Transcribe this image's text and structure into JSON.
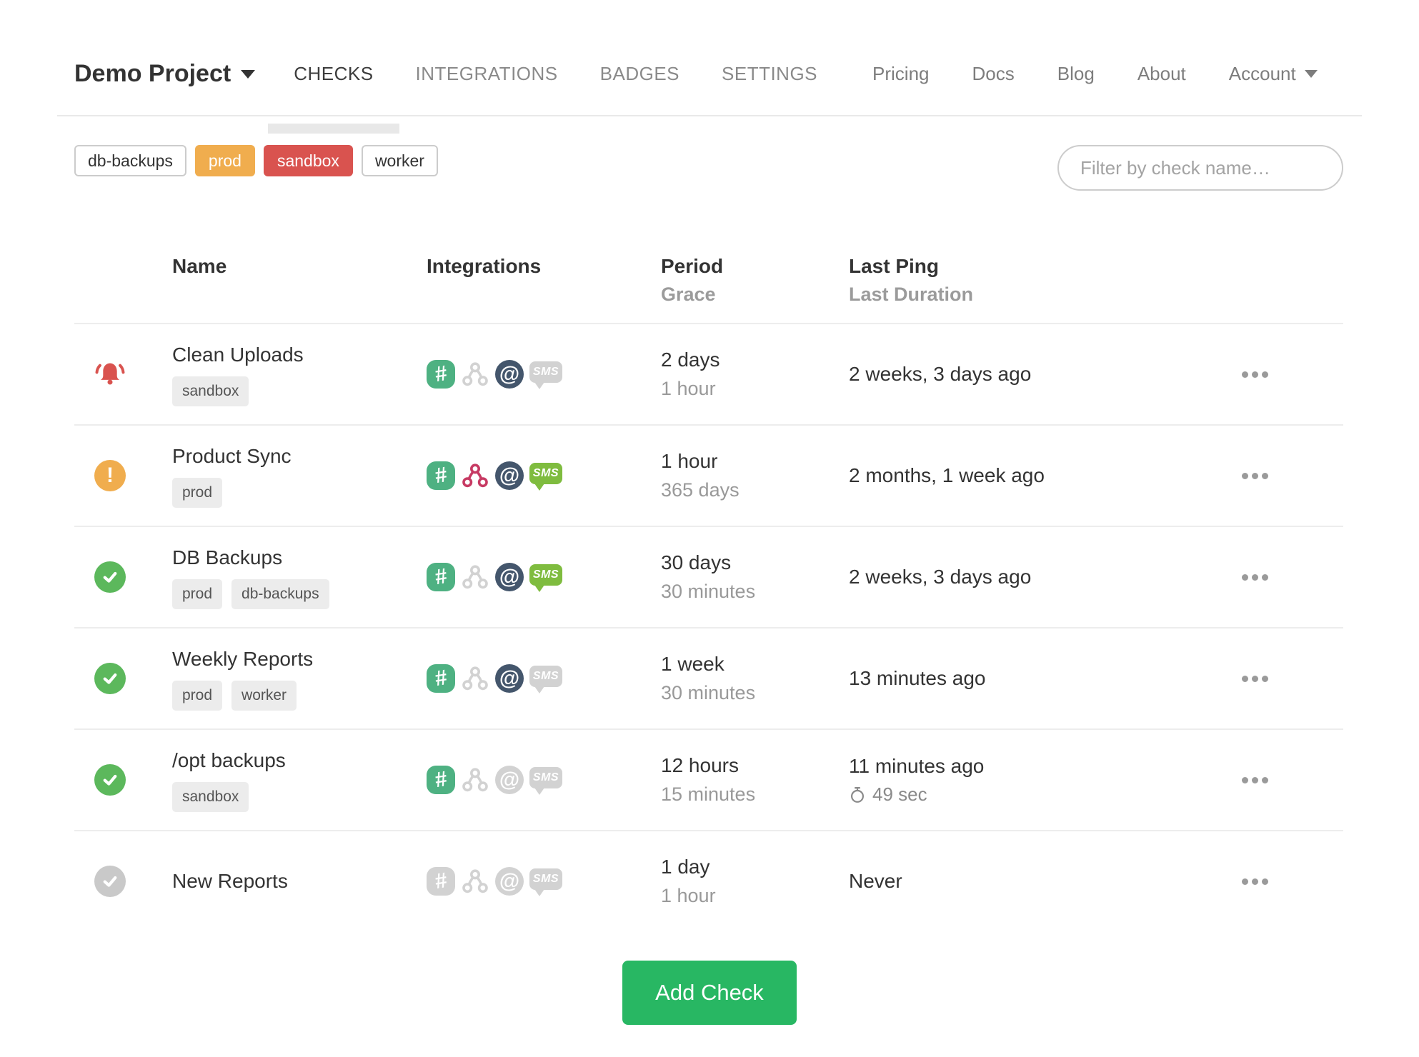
{
  "brand": {
    "name": "Demo Project"
  },
  "nav": {
    "tabs": [
      {
        "label": "CHECKS",
        "active": true
      },
      {
        "label": "INTEGRATIONS",
        "active": false
      },
      {
        "label": "BADGES",
        "active": false
      },
      {
        "label": "SETTINGS",
        "active": false
      }
    ],
    "links": [
      {
        "label": "Pricing"
      },
      {
        "label": "Docs"
      },
      {
        "label": "Blog"
      },
      {
        "label": "About"
      }
    ],
    "account_label": "Account"
  },
  "filter_bar": {
    "tag_buttons": [
      {
        "label": "db-backups",
        "variant": "outline"
      },
      {
        "label": "prod",
        "variant": "orange"
      },
      {
        "label": "sandbox",
        "variant": "red"
      },
      {
        "label": "worker",
        "variant": "outline"
      }
    ],
    "search_placeholder": "Filter by check name…"
  },
  "table": {
    "headers": {
      "name": "Name",
      "integrations": "Integrations",
      "period": "Period",
      "grace": "Grace",
      "last_ping": "Last Ping",
      "last_duration": "Last Duration"
    },
    "rows": [
      {
        "status": "alert",
        "name": "Clean Uploads",
        "tags": [
          "sandbox"
        ],
        "integrations": {
          "slack": true,
          "webhook": false,
          "email": true,
          "sms": false
        },
        "period": "2 days",
        "grace": "1 hour",
        "last_ping": "2 weeks, 3 days ago",
        "last_duration": null
      },
      {
        "status": "late",
        "name": "Product Sync",
        "tags": [
          "prod"
        ],
        "integrations": {
          "slack": true,
          "webhook": true,
          "email": true,
          "sms": true
        },
        "period": "1 hour",
        "grace": "365 days",
        "last_ping": "2 months, 1 week ago",
        "last_duration": null
      },
      {
        "status": "up",
        "name": "DB Backups",
        "tags": [
          "prod",
          "db-backups"
        ],
        "integrations": {
          "slack": true,
          "webhook": false,
          "email": true,
          "sms": true
        },
        "period": "30 days",
        "grace": "30 minutes",
        "last_ping": "2 weeks, 3 days ago",
        "last_duration": null
      },
      {
        "status": "up",
        "name": "Weekly Reports",
        "tags": [
          "prod",
          "worker"
        ],
        "integrations": {
          "slack": true,
          "webhook": false,
          "email": true,
          "sms": false
        },
        "period": "1 week",
        "grace": "30 minutes",
        "last_ping": "13 minutes ago",
        "last_duration": null
      },
      {
        "status": "up",
        "name": "/opt backups",
        "tags": [
          "sandbox"
        ],
        "integrations": {
          "slack": true,
          "webhook": false,
          "email": false,
          "sms": false
        },
        "period": "12 hours",
        "grace": "15 minutes",
        "last_ping": "11 minutes ago",
        "last_duration": "49 sec"
      },
      {
        "status": "new",
        "name": "New Reports",
        "tags": [],
        "integrations": {
          "slack": false,
          "webhook": false,
          "email": false,
          "sms": false
        },
        "period": "1 day",
        "grace": "1 hour",
        "last_ping": "Never",
        "last_duration": null
      }
    ]
  },
  "add_check_label": "Add Check",
  "colors": {
    "status_up": "#5cb85c",
    "status_late": "#f0ad4e",
    "status_alert": "#d9534f",
    "status_new": "#c9c9c9",
    "tag_orange": "#f0ad4e",
    "tag_red": "#d9534f",
    "slack": "#4eb182",
    "webhook": "#c73a63",
    "email": "#44566c",
    "sms": "#7fbc3f",
    "icon_inactive": "#d2d2d2",
    "add_check": "#28b763"
  }
}
